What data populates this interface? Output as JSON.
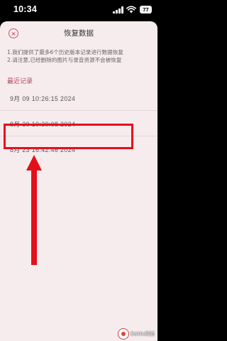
{
  "status_bar": {
    "time": "10:34",
    "battery": "77",
    "icons": [
      "signal-icon",
      "wifi-icon",
      "battery-icon"
    ]
  },
  "header": {
    "title": "恢复数据",
    "close_icon": "close-icon"
  },
  "info": {
    "line1": "1.我们提供了最多6个历史版本记录进行数据恢复",
    "line2": "2.请注意,已经删除的图片与录音资源不会被恢复"
  },
  "recent": {
    "title": "最近记录",
    "records": [
      "9月 09 10:26:15 2024",
      "8月 30 10:30:08 2024",
      "8月 23 16:42:46 2024"
    ]
  },
  "annotation": {
    "color": "#e3101b"
  },
  "watermark": {
    "text": "Baidu经验"
  },
  "colors": {
    "accent": "#b2475c",
    "background": "#f6ecee",
    "annotation": "#e3101b"
  }
}
